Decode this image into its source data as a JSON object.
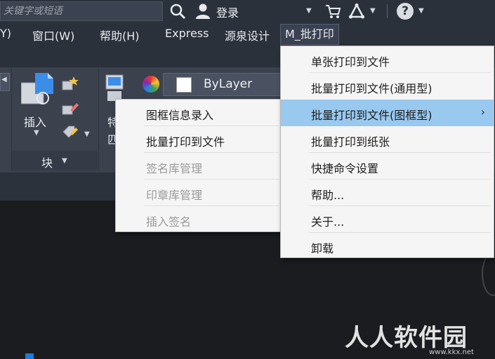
{
  "titlebar": {
    "search_placeholder": "关键字或短语",
    "login_label": "登录"
  },
  "menubar": {
    "items": [
      "Y)",
      "窗口(W)",
      "帮助(H)",
      "Express",
      "源泉设计",
      "M_批打印"
    ]
  },
  "ribbon": {
    "insert_label": "插入",
    "block_label": "块",
    "bylayer_label": "ByLayer",
    "partial_label_1": "特",
    "partial_label_2": "匹"
  },
  "main_dropdown": {
    "items": [
      {
        "label": "单张打印到文件"
      },
      {
        "label": "批量打印到文件(通用型)"
      },
      {
        "label": "批量打印到文件(图框型)",
        "has_submenu": true,
        "highlighted": true
      },
      {
        "label": "批量打印到纸张"
      },
      {
        "label": "快捷命令设置"
      },
      {
        "label": "帮助..."
      },
      {
        "label": "关于..."
      },
      {
        "label": "卸载"
      }
    ],
    "submenu_arrow": "›"
  },
  "sub_dropdown": {
    "items": [
      {
        "label": "图框信息录入",
        "enabled": true
      },
      {
        "label": "批量打印到文件",
        "enabled": true
      },
      {
        "label": "签名库管理",
        "enabled": false
      },
      {
        "label": "印章库管理",
        "enabled": false
      },
      {
        "label": "插入签名",
        "enabled": false
      }
    ]
  },
  "watermark": {
    "text": "人人软件园",
    "url": "www.kkx.net"
  },
  "colors": {
    "highlight": "#99c9ef",
    "menu_bg": "#f5f5f5",
    "chrome_bg": "#2b313b",
    "ribbon_bg": "#3b414d"
  }
}
